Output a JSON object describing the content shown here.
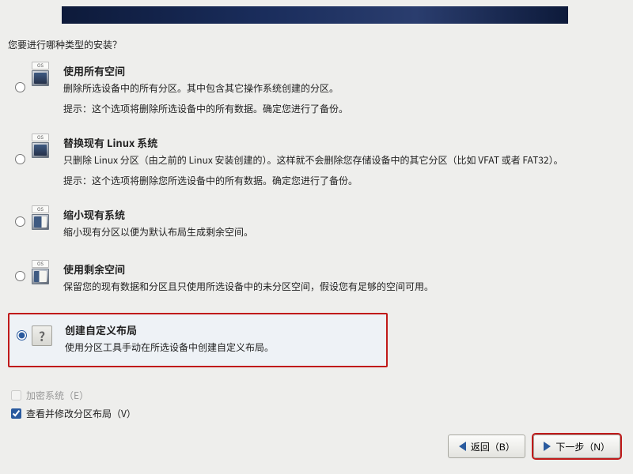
{
  "question": "您要进行哪种类型的安装？",
  "options": {
    "use_all": {
      "title": "使用所有空间",
      "desc": "删除所选设备中的所有分区。其中包含其它操作系统创建的分区。",
      "hint": "提示：这个选项将删除所选设备中的所有数据。确定您进行了备份。"
    },
    "replace_linux": {
      "title": "替换现有 Linux 系统",
      "desc": "只删除 Linux 分区（由之前的 Linux 安装创建的）。这样就不会删除您存储设备中的其它分区（比如 VFAT 或者 FAT32）。",
      "hint": "提示：这个选项将删除您所选设备中的所有数据。确定您进行了备份。"
    },
    "shrink": {
      "title": "缩小现有系统",
      "desc": "缩小现有分区以便为默认布局生成剩余空间。"
    },
    "use_free": {
      "title": "使用剩余空间",
      "desc": "保留您的现有数据和分区且只使用所选设备中的未分区空间，假设您有足够的空间可用。"
    },
    "custom": {
      "title": "创建自定义布局",
      "desc": "使用分区工具手动在所选设备中创建自定义布局。"
    }
  },
  "selected_option": "custom",
  "checkboxes": {
    "encrypt": {
      "label": "加密系统（E）",
      "checked": false,
      "enabled": false
    },
    "review": {
      "label": "查看并修改分区布局（V）",
      "checked": true,
      "enabled": true
    }
  },
  "buttons": {
    "back": "返回（B）",
    "next": "下一步（N）"
  },
  "icon_os_tag": "OS"
}
